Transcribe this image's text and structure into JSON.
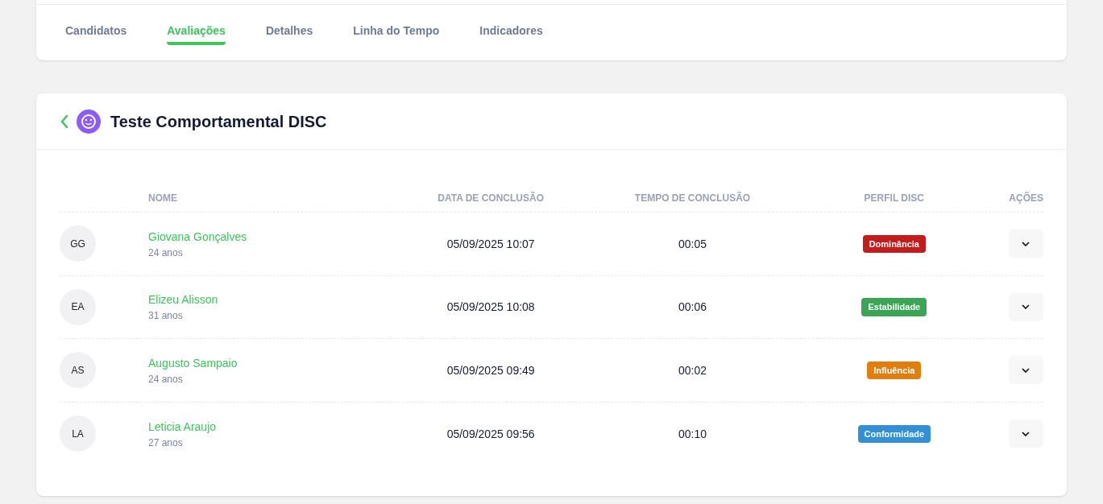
{
  "tabs": [
    {
      "label": "Candidatos",
      "selected": false
    },
    {
      "label": "Avaliações",
      "selected": true
    },
    {
      "label": "Detalhes",
      "selected": false
    },
    {
      "label": "Linha do Tempo",
      "selected": false
    },
    {
      "label": "Indicadores",
      "selected": false
    }
  ],
  "assessment": {
    "title": "Teste Comportamental DISC"
  },
  "table": {
    "columns": [
      "NOME",
      "DATA DE CONCLUSÃO",
      "TEMPO DE CONCLUSÃO",
      "PERFIL DISC",
      "AÇÕES"
    ],
    "rows": [
      {
        "initials": "GG",
        "name": "Giovana Gonçalves",
        "age": "24 anos",
        "date": "05/09/2025 10:07",
        "time": "00:05",
        "profile": "Dominância",
        "color": "#c21c1c"
      },
      {
        "initials": "EA",
        "name": "Elizeu Alisson",
        "age": "31 anos",
        "date": "05/09/2025 10:08",
        "time": "00:06",
        "profile": "Estabilidade",
        "color": "#3aa655"
      },
      {
        "initials": "AS",
        "name": "Augusto Sampaio",
        "age": "24 anos",
        "date": "05/09/2025 09:49",
        "time": "00:02",
        "profile": "Influência",
        "color": "#e07e10"
      },
      {
        "initials": "LA",
        "name": "Leticia Araujo",
        "age": "27 anos",
        "date": "05/09/2025 09:56",
        "time": "00:10",
        "profile": "Conformidade",
        "color": "#3390d4"
      }
    ]
  }
}
